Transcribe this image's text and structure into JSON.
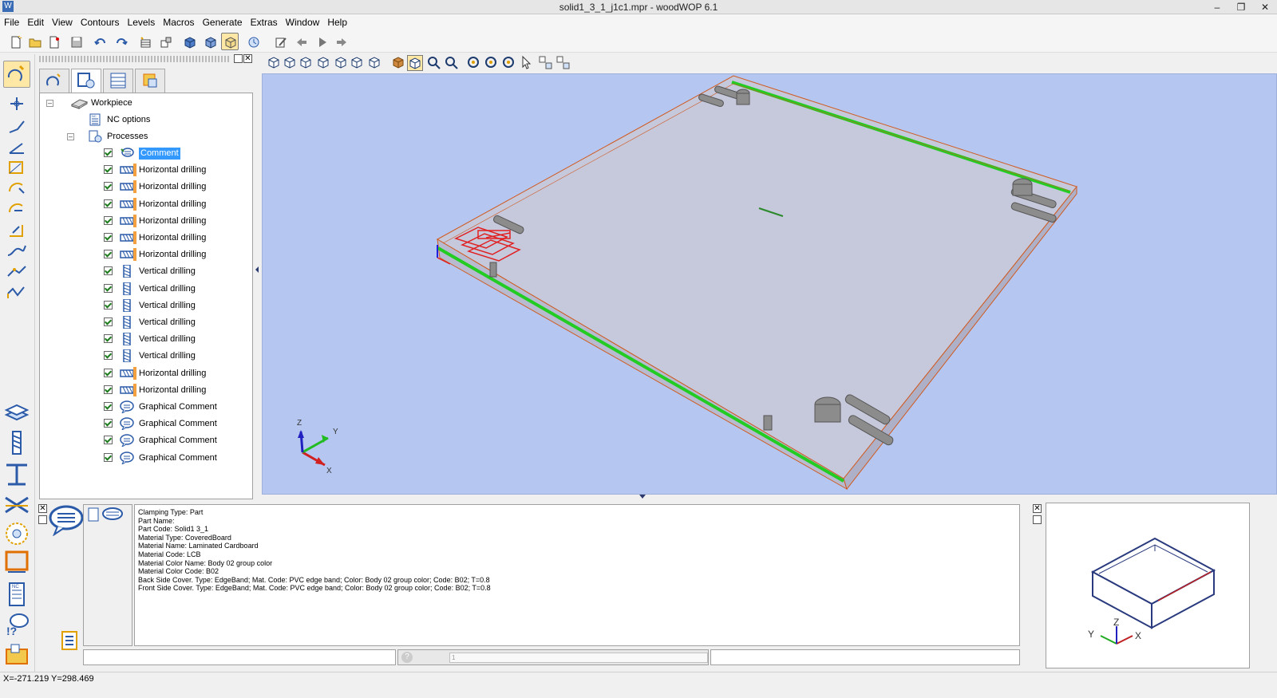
{
  "window": {
    "title": "solid1_3_1_j1c1.mpr - woodWOP 6.1",
    "controls": {
      "minimize": "–",
      "restore": "❐",
      "close": "✕"
    }
  },
  "menu": [
    "File",
    "Edit",
    "View",
    "Contours",
    "Levels",
    "Macros",
    "Generate",
    "Extras",
    "Window",
    "Help"
  ],
  "tree": {
    "workpiece": "Workpiece",
    "nc_options": "NC options",
    "processes": "Processes",
    "items": [
      {
        "label": "Comment",
        "type": "comment",
        "selected": true
      },
      {
        "label": "Horizontal drilling",
        "type": "hdrill"
      },
      {
        "label": "Horizontal drilling",
        "type": "hdrill"
      },
      {
        "label": "Horizontal drilling",
        "type": "hdrill"
      },
      {
        "label": "Horizontal drilling",
        "type": "hdrill"
      },
      {
        "label": "Horizontal drilling",
        "type": "hdrill"
      },
      {
        "label": "Horizontal drilling",
        "type": "hdrill"
      },
      {
        "label": "Vertical drilling",
        "type": "vdrill"
      },
      {
        "label": "Vertical drilling",
        "type": "vdrill"
      },
      {
        "label": "Vertical drilling",
        "type": "vdrill"
      },
      {
        "label": "Vertical drilling",
        "type": "vdrill"
      },
      {
        "label": "Vertical drilling",
        "type": "vdrill"
      },
      {
        "label": "Vertical drilling",
        "type": "vdrill"
      },
      {
        "label": "Horizontal drilling",
        "type": "hdrill"
      },
      {
        "label": "Horizontal drilling",
        "type": "hdrill"
      },
      {
        "label": "Graphical Comment",
        "type": "gcomment"
      },
      {
        "label": "Graphical Comment",
        "type": "gcomment"
      },
      {
        "label": "Graphical Comment",
        "type": "gcomment"
      },
      {
        "label": "Graphical Comment",
        "type": "gcomment"
      }
    ]
  },
  "info_lines": [
    "Clamping Type: Part",
    "Part Name:",
    "Part Code: Solid1 3_1",
    "Material Type: CoveredBoard",
    "Material Name: Laminated Cardboard",
    "Material Code: LCB",
    "Material Color Name: Body 02 group color",
    "Material Color Code: B02",
    "Back Side Cover. Type: EdgeBand; Mat. Code: PVC edge band; Color: Body 02 group color; Code: B02; T=0.8",
    "Front Side Cover. Type: EdgeBand; Mat. Code: PVC edge band; Color: Body 02 group color; Code: B02; T=0.8"
  ],
  "info_field_value": "1",
  "axes": {
    "x": "X",
    "y": "Y",
    "z": "Z"
  },
  "status": "X=-271.219 Y=298.469",
  "colors": {
    "viewport_bg": "#b5c7f0",
    "edge_band": "#22cc22",
    "selection": "#3399ff",
    "comment_marks": "#e02020"
  }
}
